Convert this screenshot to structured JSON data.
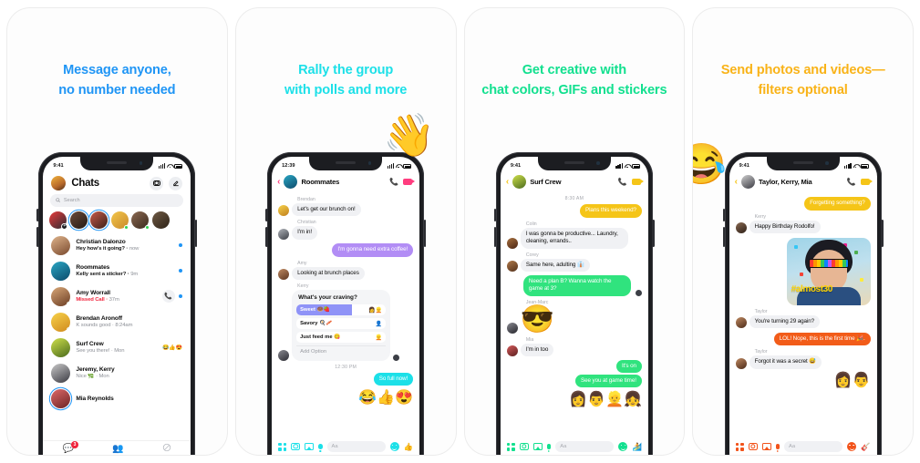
{
  "panels": [
    {
      "headline": "Message anyone,\nno number needed",
      "accent": "#1f95f5",
      "status": {
        "time": "9:41"
      },
      "app": {
        "title": "Chats",
        "camera_icon": "camera-icon",
        "compose_icon": "compose-icon",
        "search_placeholder": "Search"
      },
      "chats": [
        {
          "name": "Christian Dalonzo",
          "preview": "Hey how's it going?",
          "time": "now",
          "unread": true
        },
        {
          "name": "Roommates",
          "preview": "Kelly sent a sticker?",
          "time": "9m",
          "unread": true
        },
        {
          "name": "Amy Worrall",
          "preview": "Missed Call",
          "time": "37m",
          "missed": true,
          "unread": true
        },
        {
          "name": "Brendan Aronoff",
          "preview": "K sounds good",
          "time": "8:24am"
        },
        {
          "name": "Surf Crew",
          "preview": "See you there!",
          "time": "Mon",
          "reactions": "😂👍😍"
        },
        {
          "name": "Jeremy, Kerry",
          "preview": "Nice 🌿",
          "time": "Mon"
        },
        {
          "name": "Mia Reynolds",
          "preview": "",
          "time": ""
        }
      ],
      "tabs": [
        {
          "name": "chats-tab",
          "icon": "chat-bubble-icon",
          "badge": "3",
          "active": true
        },
        {
          "name": "people-tab",
          "icon": "people-icon",
          "badge": ""
        },
        {
          "name": "discover-tab",
          "icon": "discover-icon",
          "badge": ""
        }
      ]
    },
    {
      "headline": "Rally the group\nwith polls and more",
      "accent": "#1ce0e8",
      "bubble_out": "#1ce0e8",
      "status": {
        "time": "12:39"
      },
      "emoji_overlay": "👋",
      "conversation": {
        "title": "Roommates",
        "back_icon": "back-chevron-icon",
        "call_icon": "phone-icon",
        "video_icon": "video-icon",
        "header_color": "#ff3d7f",
        "messages": [
          {
            "type": "in",
            "sender": "Brendan",
            "text": "Let's get our brunch on!"
          },
          {
            "type": "in",
            "sender": "Christian",
            "text": "I'm in!"
          },
          {
            "type": "out",
            "text": "I'm gonna need extra coffee!",
            "color": "#b28df5"
          },
          {
            "type": "in",
            "sender": "Amy",
            "text": "Looking at brunch places"
          }
        ],
        "poll": {
          "sender": "Kerry",
          "question": "What's your craving?",
          "options": [
            {
              "label": "Sweet 🍩🍓",
              "selected": true,
              "fill_pct": 62,
              "votes": "👩👱"
            },
            {
              "label": "Savory 🍳🥓",
              "selected": false,
              "fill_pct": 0,
              "votes": "👤"
            },
            {
              "label": "Just feed me 😋",
              "selected": false,
              "fill_pct": 0,
              "votes": "👱"
            }
          ],
          "add_option": "Add Option"
        },
        "timestamp": "12:30 PM",
        "last_out": {
          "text": "So full now!",
          "color": "#1ce0e8"
        },
        "reactions": "😂👍😍"
      },
      "composer": {
        "placeholder": "Aa",
        "icons": [
          "apps-icon",
          "camera-icon",
          "gallery-icon",
          "microphone-icon"
        ],
        "emoji_icon": "smiley-icon",
        "like_icon": "👍"
      }
    },
    {
      "headline": "Get creative with\nchat colors, GIFs and stickers",
      "accent": "#12e08f",
      "status": {
        "time": "9:41"
      },
      "conversation": {
        "title": "Surf Crew",
        "back_icon": "back-chevron-icon",
        "call_icon": "phone-icon",
        "video_icon": "video-icon",
        "header_color": "#f5c518",
        "timestamp": "8:30 AM",
        "messages": [
          {
            "type": "out",
            "text": "Plans this weekend?",
            "color": "#f5c518"
          },
          {
            "type": "in",
            "sender": "Colin",
            "text": "I was gonna be productive... Laundry, cleaning, errands.."
          },
          {
            "type": "in",
            "sender": "Corey",
            "text": "Same here, adulting 👔"
          },
          {
            "type": "out",
            "text": "Need a plan B? Wanna watch the game at 3?",
            "color": "#30e37e"
          },
          {
            "type": "sticker",
            "sender": "Jean-Marc",
            "emoji": "😎"
          },
          {
            "type": "in",
            "sender": "Mia",
            "text": "I'm in too"
          },
          {
            "type": "out",
            "text": "It's on",
            "color": "#30e37e"
          },
          {
            "type": "out",
            "text": "See you at game time!",
            "color": "#30e37e"
          }
        ],
        "reactions": "👩👨👱👧"
      },
      "composer": {
        "placeholder": "Aa",
        "icons": [
          "apps-icon",
          "camera-icon",
          "gallery-icon",
          "microphone-icon"
        ],
        "emoji_icon": "smiley-icon",
        "like_icon": "🏄"
      }
    },
    {
      "headline": "Send photos and videos—\nfilters optional",
      "accent": "#f9b318",
      "status": {
        "time": "9:41"
      },
      "emoji_overlay": "😂",
      "conversation": {
        "title": "Taylor, Kerry, Mia",
        "back_icon": "back-chevron-icon",
        "call_icon": "phone-icon",
        "video_icon": "video-icon",
        "header_color": "#f5c518",
        "messages": [
          {
            "type": "out",
            "text": "Forgetting something?",
            "color": "#f5c518"
          },
          {
            "type": "in",
            "sender": "Kerry",
            "text": "Happy Birthday Rodolfo!"
          },
          {
            "type": "photo",
            "caption": "#almost30",
            "share_icon": "share-icon"
          },
          {
            "type": "in",
            "sender": "Taylor",
            "text": "You're turning 29 again?"
          },
          {
            "type": "out",
            "text": "LOL! Nope, this is the first time 🎉.",
            "color": "#f25c19"
          },
          {
            "type": "in",
            "sender": "Taylor",
            "text": "Forgot it was a secret 😅"
          }
        ],
        "reactions": "👩👨"
      },
      "composer": {
        "placeholder": "Aa",
        "icons": [
          "apps-icon",
          "camera-icon",
          "gallery-icon",
          "microphone-icon"
        ],
        "emoji_icon": "smiley-icon",
        "like_icon": "🎸"
      }
    }
  ]
}
